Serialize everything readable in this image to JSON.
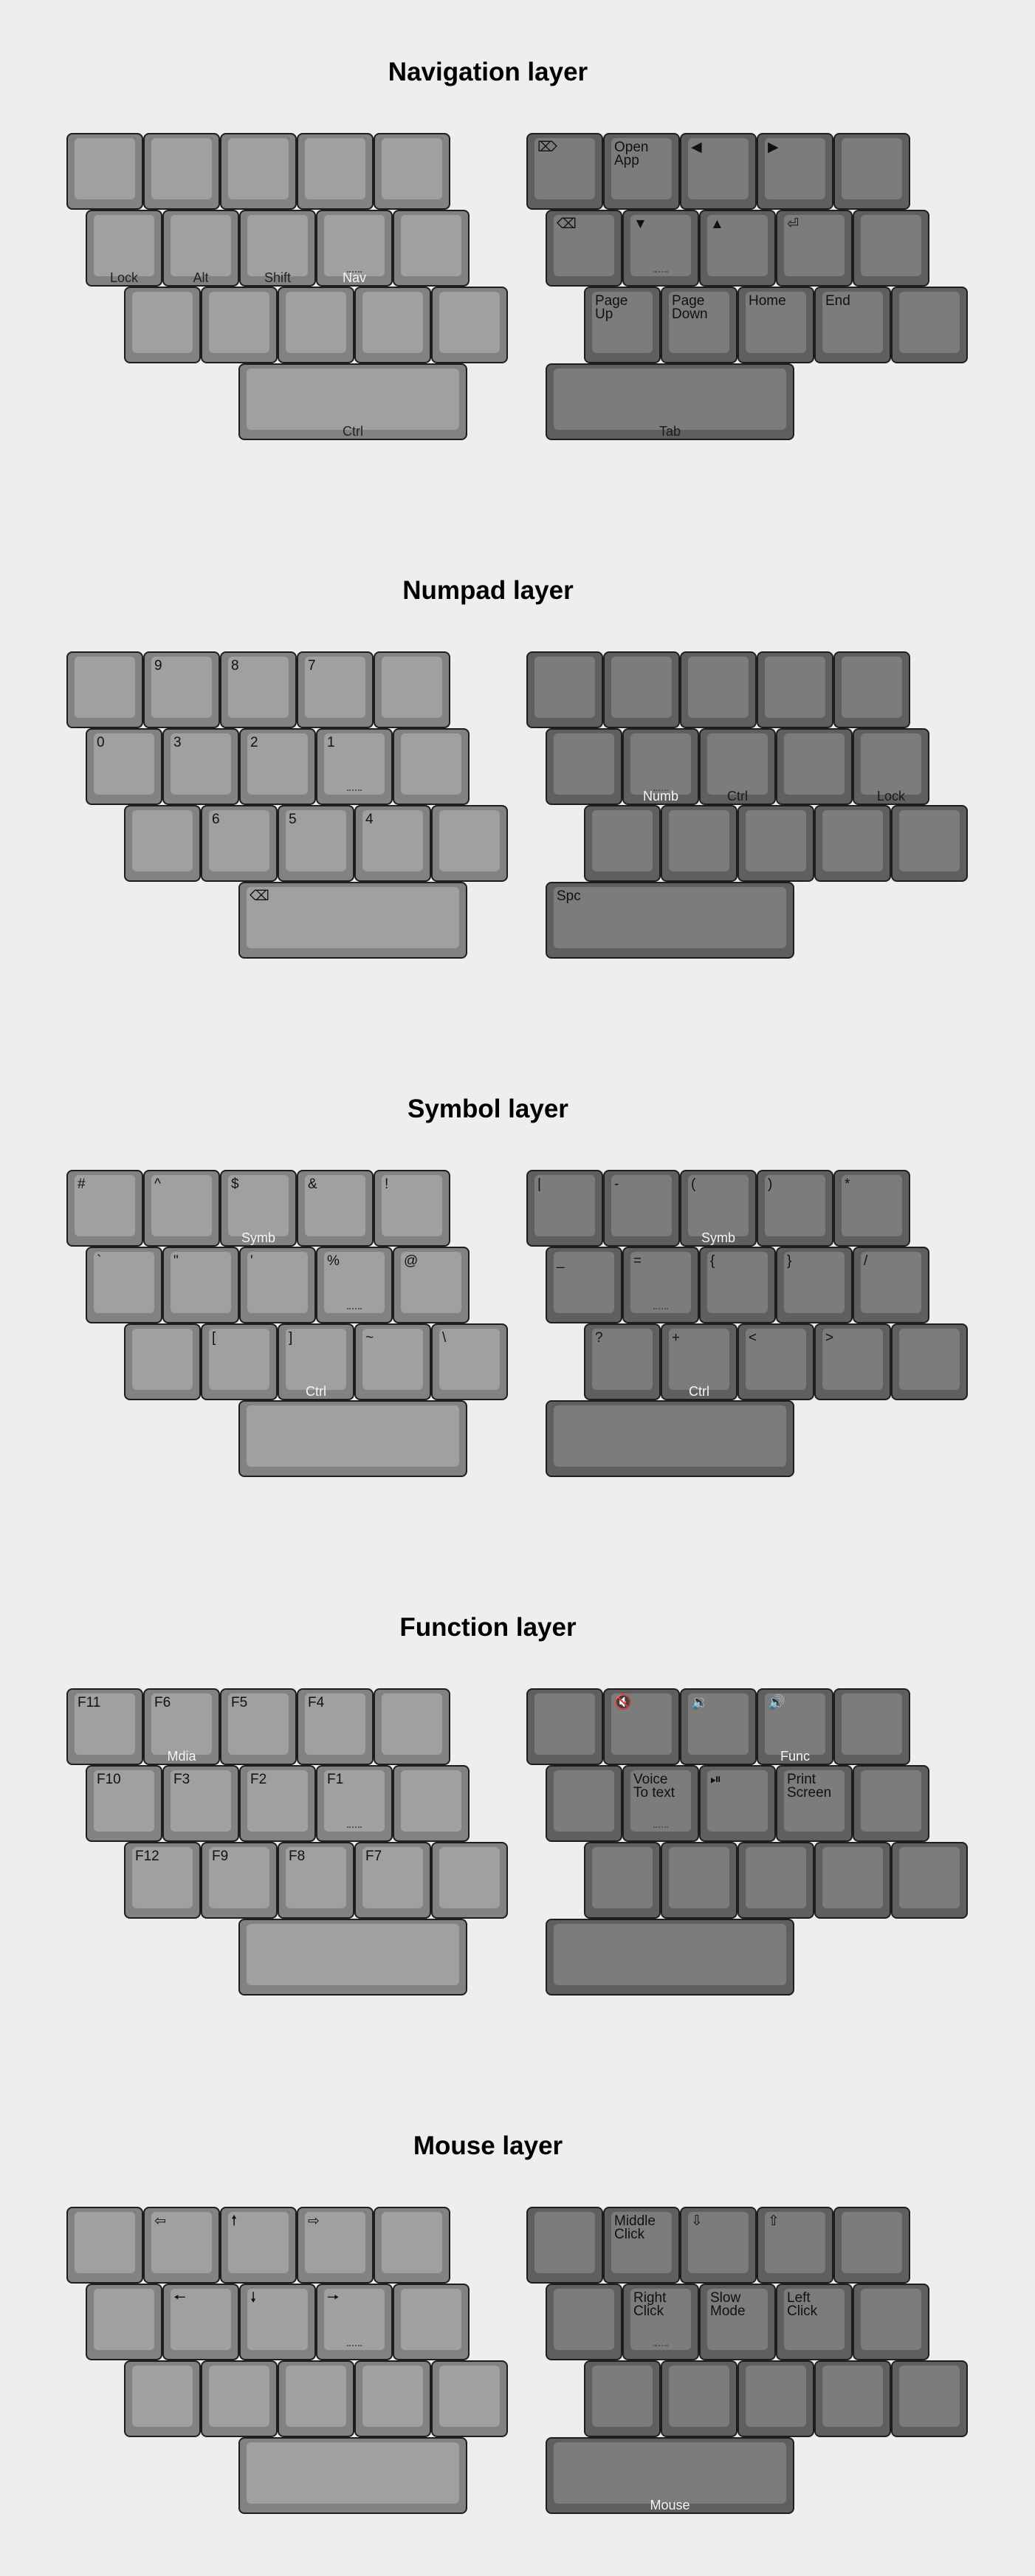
{
  "layers": [
    {
      "title": "Navigation layer",
      "left": {
        "row1": [
          {
            "label": ""
          },
          {
            "label": ""
          },
          {
            "label": ""
          },
          {
            "label": ""
          },
          {
            "label": ""
          }
        ],
        "row2": [
          {
            "label": "",
            "hold": "Lock"
          },
          {
            "label": "",
            "hold": "Alt"
          },
          {
            "label": "",
            "hold": "Shift"
          },
          {
            "label": "",
            "hold": "Nav",
            "hold_light": true,
            "homing": true
          },
          {
            "label": ""
          }
        ],
        "row3": [
          {
            "label": ""
          },
          {
            "label": ""
          },
          {
            "label": ""
          },
          {
            "label": ""
          },
          {
            "label": ""
          }
        ],
        "thumb": {
          "label": "",
          "hold": "Ctrl"
        }
      },
      "right": {
        "row1": [
          {
            "label": "⌦"
          },
          {
            "label": "Open\nApp"
          },
          {
            "label": "◀"
          },
          {
            "label": "▶"
          },
          {
            "label": ""
          }
        ],
        "row2": [
          {
            "label": "⌫"
          },
          {
            "label": "▼",
            "homing": true
          },
          {
            "label": "▲"
          },
          {
            "label": "⏎"
          },
          {
            "label": ""
          }
        ],
        "row3": [
          {
            "label": "Page\nUp"
          },
          {
            "label": "Page\nDown"
          },
          {
            "label": "Home"
          },
          {
            "label": "End"
          },
          {
            "label": ""
          }
        ],
        "thumb": {
          "label": "",
          "hold": "Tab"
        }
      }
    },
    {
      "title": "Numpad layer",
      "left": {
        "row1": [
          {
            "label": ""
          },
          {
            "label": "9"
          },
          {
            "label": "8"
          },
          {
            "label": "7"
          },
          {
            "label": ""
          }
        ],
        "row2": [
          {
            "label": "0"
          },
          {
            "label": "3"
          },
          {
            "label": "2"
          },
          {
            "label": "1",
            "homing": true
          },
          {
            "label": ""
          }
        ],
        "row3": [
          {
            "label": ""
          },
          {
            "label": "6"
          },
          {
            "label": "5"
          },
          {
            "label": "4"
          },
          {
            "label": ""
          }
        ],
        "thumb": {
          "label": "⌫"
        }
      },
      "right": {
        "row1": [
          {
            "label": ""
          },
          {
            "label": ""
          },
          {
            "label": ""
          },
          {
            "label": ""
          },
          {
            "label": ""
          }
        ],
        "row2": [
          {
            "label": ""
          },
          {
            "label": "",
            "hold": "Numb",
            "hold_light": true,
            "homing": true
          },
          {
            "label": "",
            "hold": "Ctrl"
          },
          {
            "label": ""
          },
          {
            "label": "",
            "hold": "Lock"
          }
        ],
        "row3": [
          {
            "label": ""
          },
          {
            "label": ""
          },
          {
            "label": ""
          },
          {
            "label": ""
          },
          {
            "label": ""
          }
        ],
        "thumb": {
          "label": "Spc"
        }
      }
    },
    {
      "title": "Symbol layer",
      "left": {
        "row1": [
          {
            "label": "#"
          },
          {
            "label": "^"
          },
          {
            "label": "$",
            "hold": "Symb",
            "hold_light": true
          },
          {
            "label": "&"
          },
          {
            "label": "!"
          }
        ],
        "row2": [
          {
            "label": "`"
          },
          {
            "label": "\""
          },
          {
            "label": "'"
          },
          {
            "label": "%",
            "homing": true
          },
          {
            "label": "@"
          }
        ],
        "row3": [
          {
            "label": ""
          },
          {
            "label": "["
          },
          {
            "label": "]",
            "hold": "Ctrl",
            "hold_light": true
          },
          {
            "label": "~"
          },
          {
            "label": "\\"
          }
        ],
        "thumb": {
          "label": ""
        }
      },
      "right": {
        "row1": [
          {
            "label": "|"
          },
          {
            "label": "-"
          },
          {
            "label": "(",
            "hold": "Symb",
            "hold_light": true
          },
          {
            "label": ")"
          },
          {
            "label": "*"
          }
        ],
        "row2": [
          {
            "label": "_"
          },
          {
            "label": "=",
            "homing": true
          },
          {
            "label": "{"
          },
          {
            "label": "}"
          },
          {
            "label": "/"
          }
        ],
        "row3": [
          {
            "label": "?"
          },
          {
            "label": "+",
            "hold": "Ctrl",
            "hold_light": true
          },
          {
            "label": "<"
          },
          {
            "label": ">"
          },
          {
            "label": ""
          }
        ],
        "thumb": {
          "label": ""
        }
      }
    },
    {
      "title": "Function layer",
      "left": {
        "row1": [
          {
            "label": "F11"
          },
          {
            "label": "F6",
            "hold": "Mdia",
            "hold_light": true
          },
          {
            "label": "F5"
          },
          {
            "label": "F4"
          },
          {
            "label": ""
          }
        ],
        "row2": [
          {
            "label": "F10"
          },
          {
            "label": "F3"
          },
          {
            "label": "F2"
          },
          {
            "label": "F1",
            "homing": true
          },
          {
            "label": ""
          }
        ],
        "row3": [
          {
            "label": "F12"
          },
          {
            "label": "F9"
          },
          {
            "label": "F8"
          },
          {
            "label": "F7"
          },
          {
            "label": ""
          }
        ],
        "thumb": {
          "label": ""
        }
      },
      "right": {
        "row1": [
          {
            "label": ""
          },
          {
            "label": "🔇"
          },
          {
            "label": "🔉"
          },
          {
            "label": "🔊",
            "hold": "Func",
            "hold_light": true
          },
          {
            "label": ""
          }
        ],
        "row2": [
          {
            "label": ""
          },
          {
            "label": "Voice\nTo text",
            "homing": true
          },
          {
            "label": "⏯"
          },
          {
            "label": "Print\nScreen"
          },
          {
            "label": ""
          }
        ],
        "row3": [
          {
            "label": ""
          },
          {
            "label": ""
          },
          {
            "label": ""
          },
          {
            "label": ""
          },
          {
            "label": ""
          }
        ],
        "thumb": {
          "label": ""
        }
      }
    },
    {
      "title": "Mouse layer",
      "left": {
        "row1": [
          {
            "label": ""
          },
          {
            "label": "⇦"
          },
          {
            "label": "🠕"
          },
          {
            "label": "⇨"
          },
          {
            "label": ""
          }
        ],
        "row2": [
          {
            "label": ""
          },
          {
            "label": "🠔"
          },
          {
            "label": "🠗"
          },
          {
            "label": "🠖",
            "homing": true
          },
          {
            "label": ""
          }
        ],
        "row3": [
          {
            "label": ""
          },
          {
            "label": ""
          },
          {
            "label": ""
          },
          {
            "label": ""
          },
          {
            "label": ""
          }
        ],
        "thumb": {
          "label": ""
        }
      },
      "right": {
        "row1": [
          {
            "label": ""
          },
          {
            "label": "Middle\nClick"
          },
          {
            "label": "⇩"
          },
          {
            "label": "⇧"
          },
          {
            "label": ""
          }
        ],
        "row2": [
          {
            "label": ""
          },
          {
            "label": "Right\nClick",
            "homing": true
          },
          {
            "label": "Slow\nMode"
          },
          {
            "label": "Left\nClick"
          },
          {
            "label": ""
          }
        ],
        "row3": [
          {
            "label": ""
          },
          {
            "label": ""
          },
          {
            "label": ""
          },
          {
            "label": ""
          },
          {
            "label": ""
          }
        ],
        "thumb": {
          "label": "",
          "hold": "Mouse",
          "hold_light": true
        }
      }
    }
  ],
  "colors": {
    "background": "#eeeeee",
    "left_key": "#828282",
    "left_cap": "#a0a0a0",
    "right_key": "#5f5f5f",
    "right_cap": "#7c7c7c",
    "border": "#1e1e1e"
  }
}
